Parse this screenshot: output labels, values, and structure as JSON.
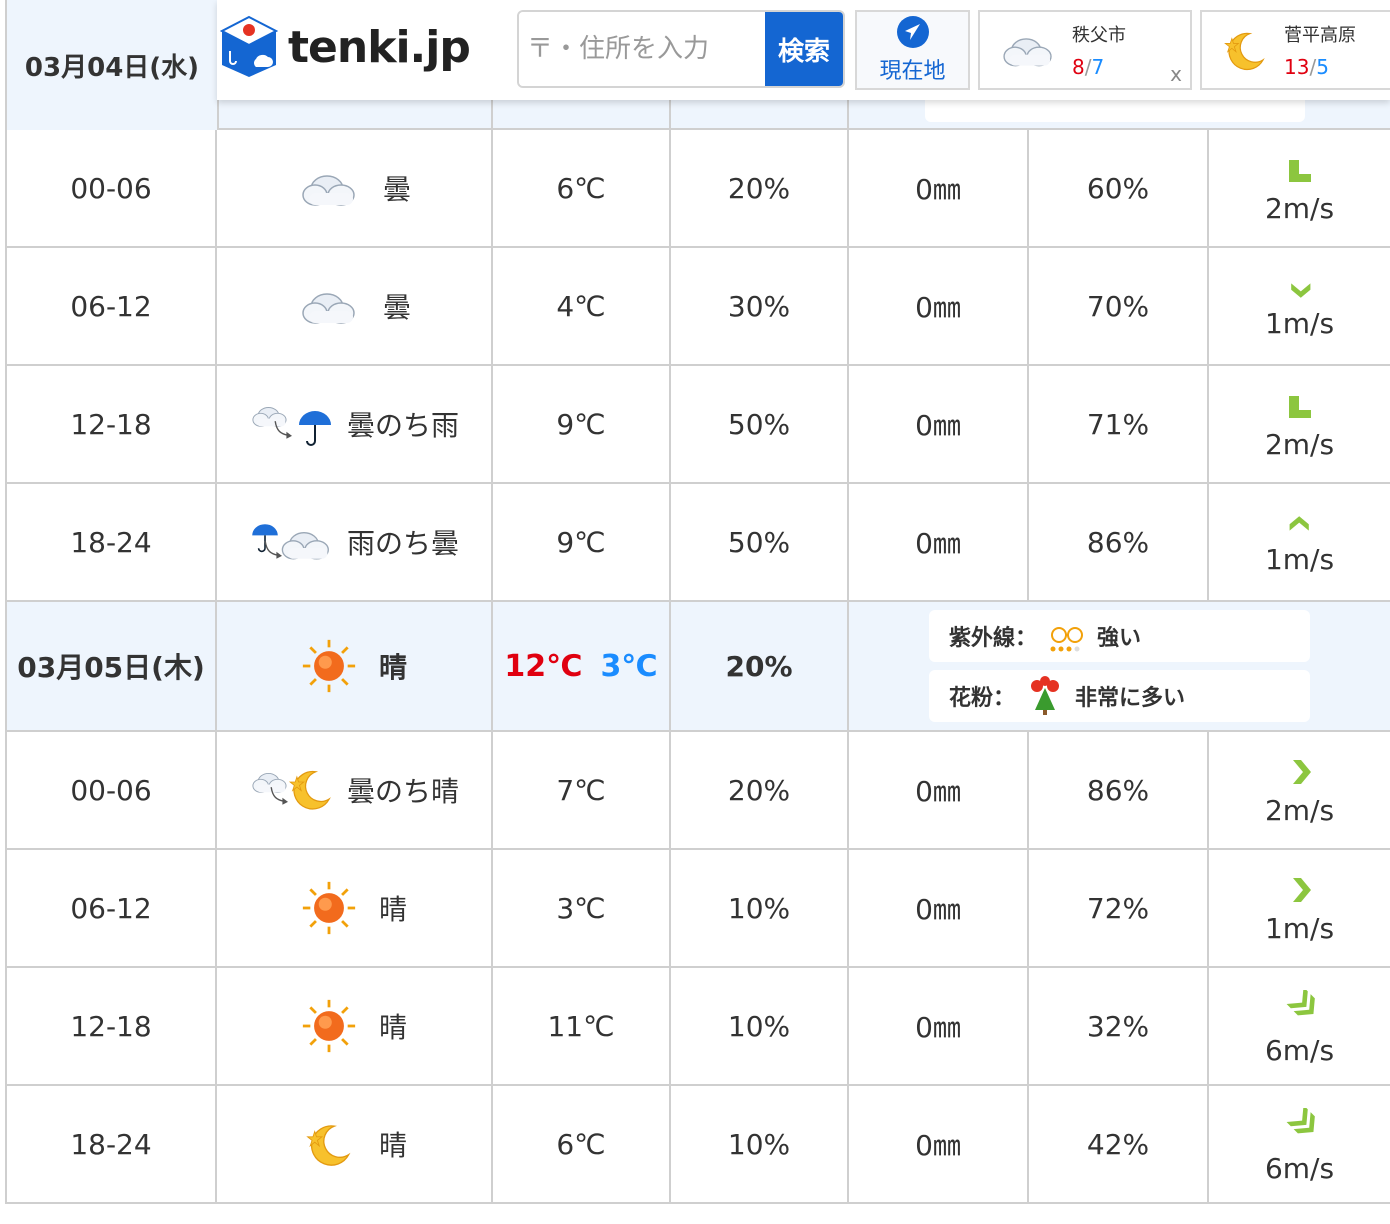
{
  "header": {
    "date_label": "03月04日(水)",
    "logo_text": "tenki.jp",
    "search_placeholder": "〒・住所を入力",
    "search_button": "検索",
    "current_location_label": "現在地",
    "cards": [
      {
        "name": "秩父市",
        "max": "8",
        "min": "7",
        "icon": "cloud-icon",
        "close": "x"
      },
      {
        "name": "菅平高原",
        "max": "13",
        "min": "5",
        "icon": "moon-icon"
      }
    ]
  },
  "day1_rows": [
    {
      "time": "00-06",
      "icon": "cloud-icon",
      "weather": "曇",
      "temp": "6℃",
      "precip_prob": "20%",
      "precip": "0㎜",
      "humidity": "60%",
      "wind": "2m/s",
      "wind_dir_icon": "wind-arrow-icon"
    },
    {
      "time": "06-12",
      "icon": "cloud-icon",
      "weather": "曇",
      "temp": "4℃",
      "precip_prob": "30%",
      "precip": "0㎜",
      "humidity": "70%",
      "wind": "1m/s",
      "wind_dir_icon": "wind-arrow-icon"
    },
    {
      "time": "12-18",
      "icon": "cloud-then-rain-icon",
      "weather": "曇のち雨",
      "temp": "9℃",
      "precip_prob": "50%",
      "precip": "0㎜",
      "humidity": "71%",
      "wind": "2m/s",
      "wind_dir_icon": "wind-arrow-icon"
    },
    {
      "time": "18-24",
      "icon": "rain-then-cloud-icon",
      "weather": "雨のち曇",
      "temp": "9℃",
      "precip_prob": "50%",
      "precip": "0㎜",
      "humidity": "86%",
      "wind": "1m/s",
      "wind_dir_icon": "wind-arrow-icon"
    }
  ],
  "day2": {
    "date_label": "03月05日(木)",
    "weather": "晴",
    "max_temp": "12℃",
    "min_temp": "3℃",
    "precip_prob": "20%",
    "uv_label": "紫外線：",
    "uv_value": "強い",
    "pollen_label": "花粉：",
    "pollen_value": "非常に多い"
  },
  "day2_rows": [
    {
      "time": "00-06",
      "icon": "cloud-then-moon-icon",
      "weather": "曇のち晴",
      "temp": "7℃",
      "precip_prob": "20%",
      "precip": "0㎜",
      "humidity": "86%",
      "wind": "2m/s"
    },
    {
      "time": "06-12",
      "icon": "sun-icon",
      "weather": "晴",
      "temp": "3℃",
      "precip_prob": "10%",
      "precip": "0㎜",
      "humidity": "72%",
      "wind": "1m/s"
    },
    {
      "time": "12-18",
      "icon": "sun-icon",
      "weather": "晴",
      "temp": "11℃",
      "precip_prob": "10%",
      "precip": "0㎜",
      "humidity": "32%",
      "wind": "6m/s"
    },
    {
      "time": "18-24",
      "icon": "moon-icon",
      "weather": "晴",
      "temp": "6℃",
      "precip_prob": "10%",
      "precip": "0㎜",
      "humidity": "42%",
      "wind": "6m/s"
    }
  ],
  "colors": {
    "max": "#e00010",
    "min": "#1a8cff",
    "brand": "#1466d2",
    "wind": "#8cc63f"
  }
}
